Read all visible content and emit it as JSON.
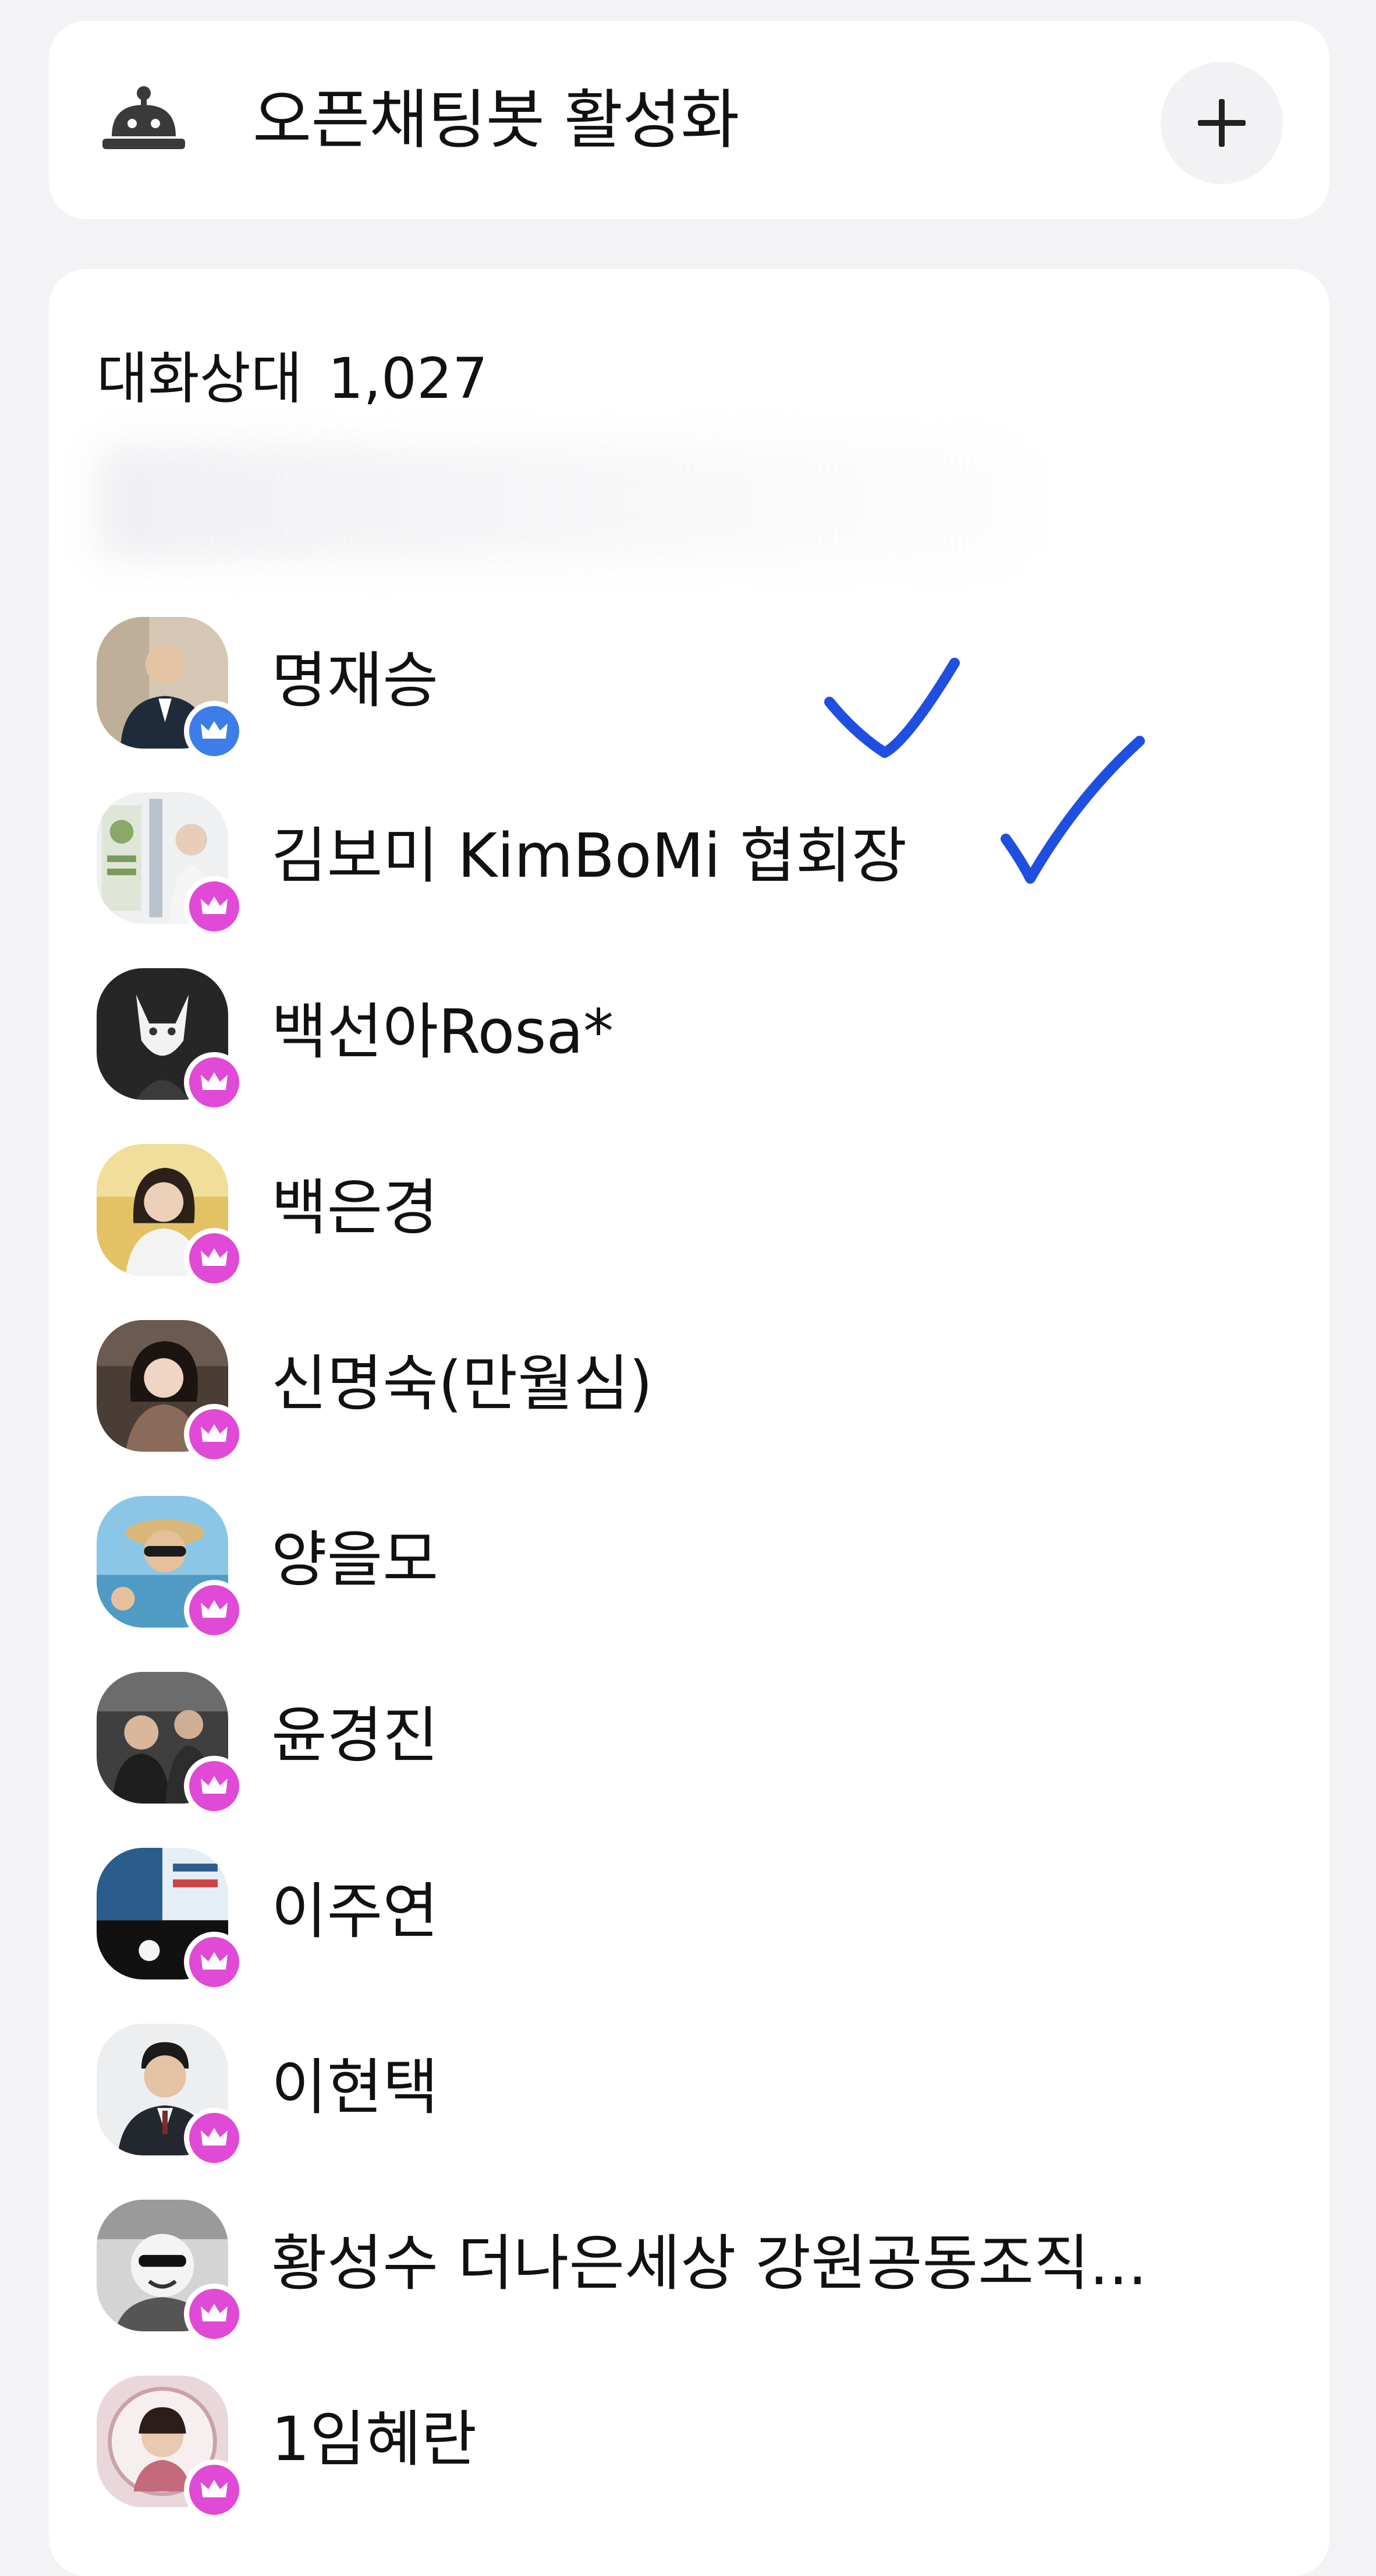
{
  "bot": {
    "title": "오픈채팅봇 활성화",
    "icon": "bell-robot-icon",
    "add_icon": "plus-icon"
  },
  "participants": {
    "label": "대화상대",
    "count": "1,027",
    "members": [
      {
        "name": "명재승",
        "badge_color": "#3d7dea",
        "avatar_bg": "#d6c7b4",
        "checked": true
      },
      {
        "name": "김보미 KimBoMi 협회장",
        "badge_color": "#e04ad6",
        "avatar_bg": "#e9ecef",
        "checked": true
      },
      {
        "name": "백선아Rosa*",
        "badge_color": "#e04ad6",
        "avatar_bg": "#2a2a2a",
        "checked": false
      },
      {
        "name": "백은경",
        "badge_color": "#e04ad6",
        "avatar_bg": "#e0c065",
        "checked": false
      },
      {
        "name": "신명숙(만월심)",
        "badge_color": "#e04ad6",
        "avatar_bg": "#5a4a42",
        "checked": false
      },
      {
        "name": "양을모",
        "badge_color": "#e04ad6",
        "avatar_bg": "#7fb9d9",
        "checked": false
      },
      {
        "name": "윤경진",
        "badge_color": "#e04ad6",
        "avatar_bg": "#4b4b4b",
        "checked": false
      },
      {
        "name": "이주연",
        "badge_color": "#e04ad6",
        "avatar_bg": "#1f3a5a",
        "checked": false
      },
      {
        "name": "이현택",
        "badge_color": "#e04ad6",
        "avatar_bg": "#e8eaec",
        "checked": false
      },
      {
        "name": "황성수 더나은세상 강원공동조직...",
        "badge_color": "#e04ad6",
        "avatar_bg": "#cfcfcf",
        "checked": false
      },
      {
        "name": "1임혜란",
        "badge_color": "#e04ad6",
        "avatar_bg": "#e7d4d9",
        "checked": false
      }
    ]
  },
  "annotation_color": "#1f4fe0"
}
